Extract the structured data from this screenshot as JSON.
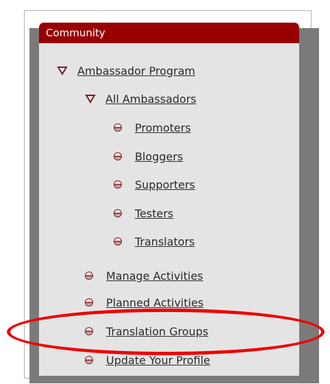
{
  "panel": {
    "title": "Community"
  },
  "nav": {
    "ambassador_program": "Ambassador Program",
    "all_ambassadors": "All Ambassadors",
    "sub_items": [
      "Promoters",
      "Bloggers",
      "Supporters",
      "Testers",
      "Translators"
    ],
    "manage_activities": "Manage Activities",
    "planned_activities": "Planned Activities",
    "translation_groups": "Translation Groups",
    "update_profile": "Update Your Profile"
  },
  "colors": {
    "header_bg": "#980000",
    "highlight_ellipse": "#ee0000"
  }
}
